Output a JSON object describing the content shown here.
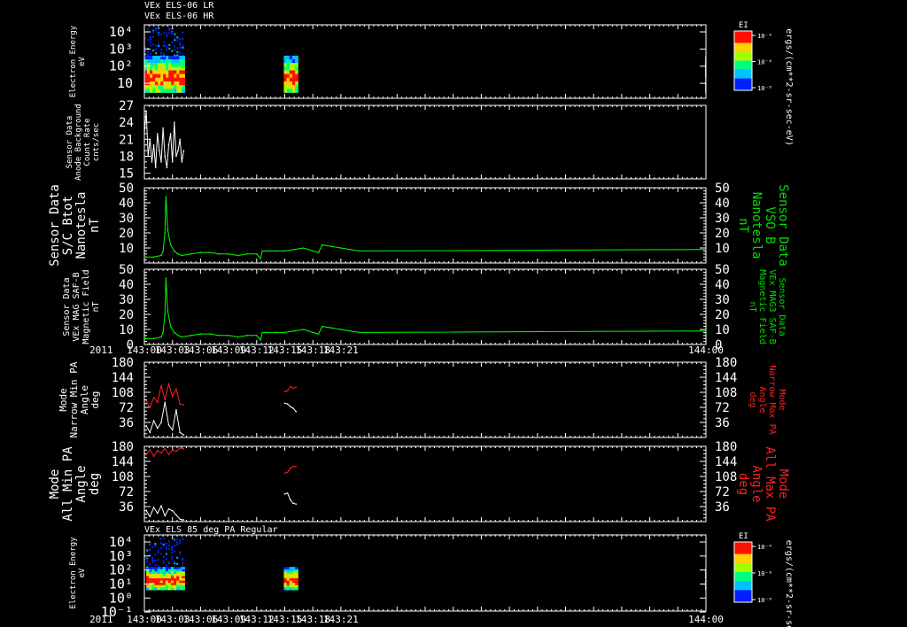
{
  "header": {
    "line1": "VEx ELS-06 LR",
    "line2": "VEx ELS-06 HR",
    "bottom_panel_title": "VEx ELS 85 deg PA Regular",
    "year": "2011"
  },
  "colorbar": {
    "label": "EI",
    "ticks": [
      "10⁻⁴",
      "10⁻⁶",
      "10⁻⁸"
    ],
    "unit": "ergs/(cm**2-sr-sec-eV)"
  },
  "time_axis": {
    "ticks": [
      "143:00",
      "143:03",
      "143:06",
      "143:09",
      "143:12",
      "143:15",
      "143:18",
      "143:21",
      "144:00"
    ]
  },
  "chart_data": [
    {
      "type": "heatmap",
      "name": "electron-energy-spectrogram-top",
      "ylabel": [
        "Electron Energy",
        "eV"
      ],
      "yticks": [
        "10⁴",
        "10³",
        "10²",
        "10"
      ],
      "ylog": true,
      "data_segments": [
        {
          "t_start": "143:00",
          "t_end": "143:04.3"
        },
        {
          "t_start": "143:14.9",
          "t_end": "143:16.4"
        },
        {
          "t_start": "143:59.9",
          "t_end": "144:00"
        }
      ]
    },
    {
      "type": "line",
      "name": "sensor-data-anode-background",
      "ylabel": [
        "Sensor Data",
        "Anode Background",
        "Count Rate",
        "cnts/sec"
      ],
      "ylim": [
        14,
        27
      ],
      "yticks": [
        27,
        24,
        21,
        18,
        15
      ],
      "series": [
        {
          "color": "#ffffff",
          "x": [
            "143:00.0",
            "143:00.2",
            "143:00.4",
            "143:00.6",
            "143:00.8",
            "143:01.0",
            "143:01.2",
            "143:01.4",
            "143:01.6",
            "143:01.8",
            "143:02.0",
            "143:02.2",
            "143:02.4",
            "143:02.6",
            "143:02.8",
            "143:03.0",
            "143:03.2",
            "143:03.4",
            "143:03.6",
            "143:03.8",
            "143:04.0",
            "143:04.2"
          ],
          "values": [
            22,
            26,
            18,
            21,
            17,
            20,
            16,
            22,
            19,
            17,
            23,
            18,
            16,
            20,
            22,
            17,
            24,
            18,
            19,
            21,
            17,
            19
          ]
        }
      ]
    },
    {
      "type": "line",
      "name": "sensor-data-sc-btot",
      "ylabel": [
        "Sensor Data",
        "S/C Btot",
        "Nanotesla",
        "nT"
      ],
      "ylabel_right": [
        "Sensor Data",
        "VSO B",
        "Nanotesla",
        "nT"
      ],
      "ylim": [
        0,
        50
      ],
      "yticks": [
        50,
        40,
        30,
        20,
        10
      ],
      "series": [
        {
          "color": "#00ff00",
          "x": [
            "143:00",
            "143:01",
            "143:01.8",
            "143:02.0",
            "143:02.2",
            "143:02.3",
            "143:02.5",
            "143:02.8",
            "143:03.2",
            "143:03.6",
            "143:04",
            "143:05",
            "143:06",
            "143:07",
            "143:08",
            "143:09",
            "143:10",
            "143:11",
            "143:12",
            "143:12.4",
            "143:12.6",
            "143:13",
            "143:14",
            "143:15",
            "143:16",
            "143:17",
            "143:18",
            "143:18.6",
            "143:19",
            "143:20",
            "143:21",
            "143:22",
            "143:23",
            "144:00"
          ],
          "values": [
            4,
            4,
            5,
            8,
            20,
            44,
            22,
            12,
            8,
            6,
            5,
            6,
            7,
            7,
            6,
            6,
            5,
            6,
            6,
            3,
            8,
            8,
            8,
            8,
            9,
            10,
            8,
            7,
            12,
            11,
            10,
            9,
            8,
            9
          ]
        }
      ]
    },
    {
      "type": "line",
      "name": "sensor-data-vex-mag-saf-b",
      "ylabel": [
        "Sensor Data",
        "VEx MAG SAF-B",
        "Magnetic Field",
        "nT"
      ],
      "ylabel_right": [
        "Sensor Data",
        "VEx MAG3 SAF-B",
        "Magnetic Field",
        "nT"
      ],
      "ylim": [
        0,
        50
      ],
      "yticks": [
        50,
        40,
        30,
        20,
        10,
        0
      ],
      "series": [
        {
          "color": "#00ff00",
          "x": [
            "143:00",
            "143:01",
            "143:01.8",
            "143:02.0",
            "143:02.2",
            "143:02.3",
            "143:02.5",
            "143:02.8",
            "143:03.2",
            "143:03.6",
            "143:04",
            "143:05",
            "143:06",
            "143:07",
            "143:08",
            "143:09",
            "143:10",
            "143:11",
            "143:12",
            "143:12.4",
            "143:12.6",
            "143:13",
            "143:14",
            "143:15",
            "143:16",
            "143:17",
            "143:18",
            "143:18.6",
            "143:19",
            "143:20",
            "143:21",
            "143:22",
            "143:23",
            "144:00"
          ],
          "values": [
            4,
            4,
            5,
            8,
            20,
            44,
            22,
            12,
            8,
            6,
            5,
            6,
            7,
            7,
            6,
            6,
            5,
            6,
            6,
            3,
            8,
            8,
            8,
            8,
            9,
            10,
            8,
            7,
            12,
            11,
            10,
            9,
            8,
            9
          ]
        }
      ]
    },
    {
      "type": "line",
      "name": "mode-narrow-pa",
      "ylabel": [
        "Mode",
        "Narrow Min PA",
        "Angle",
        "deg"
      ],
      "ylabel_right": [
        "Mode",
        "Narrow Max PA",
        "Angle",
        "deg"
      ],
      "ylim": [
        0,
        180
      ],
      "yticks": [
        180,
        144,
        108,
        72,
        36
      ],
      "series": [
        {
          "color": "#ff2020",
          "segments": [
            {
              "x": [
                "143:00.2",
                "143:00.6",
                "143:01.0",
                "143:01.4",
                "143:01.8",
                "143:02.2",
                "143:02.6",
                "143:03.0",
                "143:03.4",
                "143:03.8",
                "143:04.2"
              ],
              "values": [
                88,
                72,
                96,
                84,
                124,
                90,
                128,
                98,
                116,
                80,
                78
              ]
            },
            {
              "x": [
                "143:15.0",
                "143:15.3",
                "143:15.6",
                "143:15.9",
                "143:16.2"
              ],
              "values": [
                110,
                112,
                122,
                118,
                120
              ]
            }
          ]
        },
        {
          "color": "#ffffff",
          "segments": [
            {
              "x": [
                "143:00.2",
                "143:00.6",
                "143:01.0",
                "143:01.4",
                "143:01.8",
                "143:02.2",
                "143:02.6",
                "143:03.0",
                "143:03.4",
                "143:03.8",
                "143:04.2"
              ],
              "values": [
                28,
                12,
                40,
                22,
                36,
                84,
                30,
                18,
                66,
                12,
                6
              ]
            },
            {
              "x": [
                "143:15.0",
                "143:15.3",
                "143:15.6",
                "143:15.9",
                "143:16.2"
              ],
              "values": [
                82,
                80,
                74,
                70,
                62
              ]
            }
          ]
        }
      ]
    },
    {
      "type": "line",
      "name": "mode-all-pa",
      "ylabel": [
        "Mode",
        "All Min PA",
        "Angle",
        "deg"
      ],
      "ylabel_right": [
        "Mode",
        "All Max PA",
        "Angle",
        "deg"
      ],
      "ylim": [
        0,
        180
      ],
      "yticks": [
        180,
        144,
        108,
        72,
        36
      ],
      "series": [
        {
          "color": "#ff2020",
          "segments": [
            {
              "x": [
                "143:00.2",
                "143:00.6",
                "143:01.0",
                "143:01.4",
                "143:01.8",
                "143:02.2",
                "143:02.6",
                "143:03.0",
                "143:03.4",
                "143:03.8",
                "143:04.2"
              ],
              "values": [
                160,
                172,
                156,
                170,
                164,
                175,
                160,
                172,
                168,
                176,
                174
              ]
            },
            {
              "x": [
                "143:15.0",
                "143:15.3",
                "143:15.6",
                "143:15.9",
                "143:16.2"
              ],
              "values": [
                116,
                118,
                128,
                132,
                132
              ]
            }
          ]
        },
        {
          "color": "#ffffff",
          "segments": [
            {
              "x": [
                "143:00.2",
                "143:00.6",
                "143:01.0",
                "143:01.4",
                "143:01.8",
                "143:02.2",
                "143:02.6",
                "143:03.0",
                "143:03.4",
                "143:03.8",
                "143:04.2"
              ],
              "values": [
                26,
                12,
                34,
                20,
                38,
                14,
                30,
                26,
                16,
                6,
                4
              ]
            },
            {
              "x": [
                "143:15.0",
                "143:15.3",
                "143:15.6",
                "143:15.9",
                "143:16.2"
              ],
              "values": [
                66,
                68,
                52,
                44,
                42
              ]
            }
          ]
        }
      ]
    },
    {
      "type": "heatmap",
      "name": "electron-energy-spectrogram-85deg",
      "ylabel": [
        "Electron Energy",
        "eV"
      ],
      "yticks": [
        "10⁴",
        "10³",
        "10²",
        "10¹",
        "10⁰",
        "10⁻¹"
      ],
      "ylog": true,
      "data_segments": [
        {
          "t_start": "143:00.2",
          "t_end": "143:04.3"
        },
        {
          "t_start": "143:14.9",
          "t_end": "143:16.4"
        },
        {
          "t_start": "143:59.9",
          "t_end": "144:00"
        }
      ]
    }
  ]
}
